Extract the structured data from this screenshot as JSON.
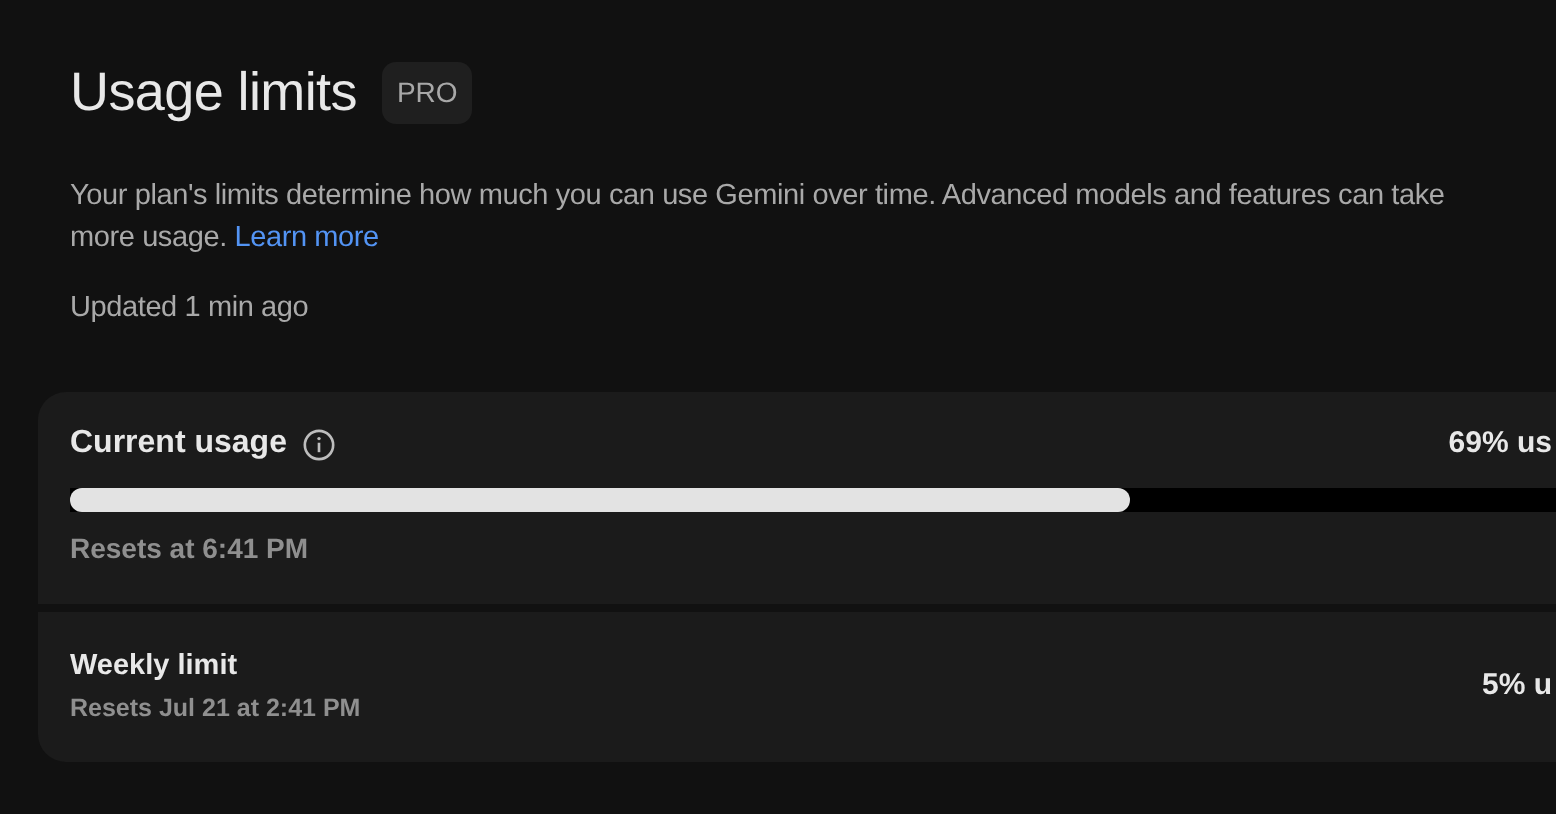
{
  "header": {
    "title": "Usage limits",
    "plan_badge": "PRO"
  },
  "description": {
    "line_1": "Your plan's limits determine how much you can use Gemini over time. Advanced models and features can take",
    "line_2": "more usage.",
    "link": "Learn more"
  },
  "updated": "Updated 1 min ago",
  "limits": [
    {
      "kind": "bar",
      "title": "Current usage",
      "info_icon": true,
      "usage": "69% us",
      "level": 0.69,
      "resets": "Resets at 6:41 PM"
    },
    {
      "kind": "summary",
      "title": "Weekly limit",
      "usage": "5% u",
      "resets": "Resets Jul 21 at 2:41 PM"
    }
  ]
}
